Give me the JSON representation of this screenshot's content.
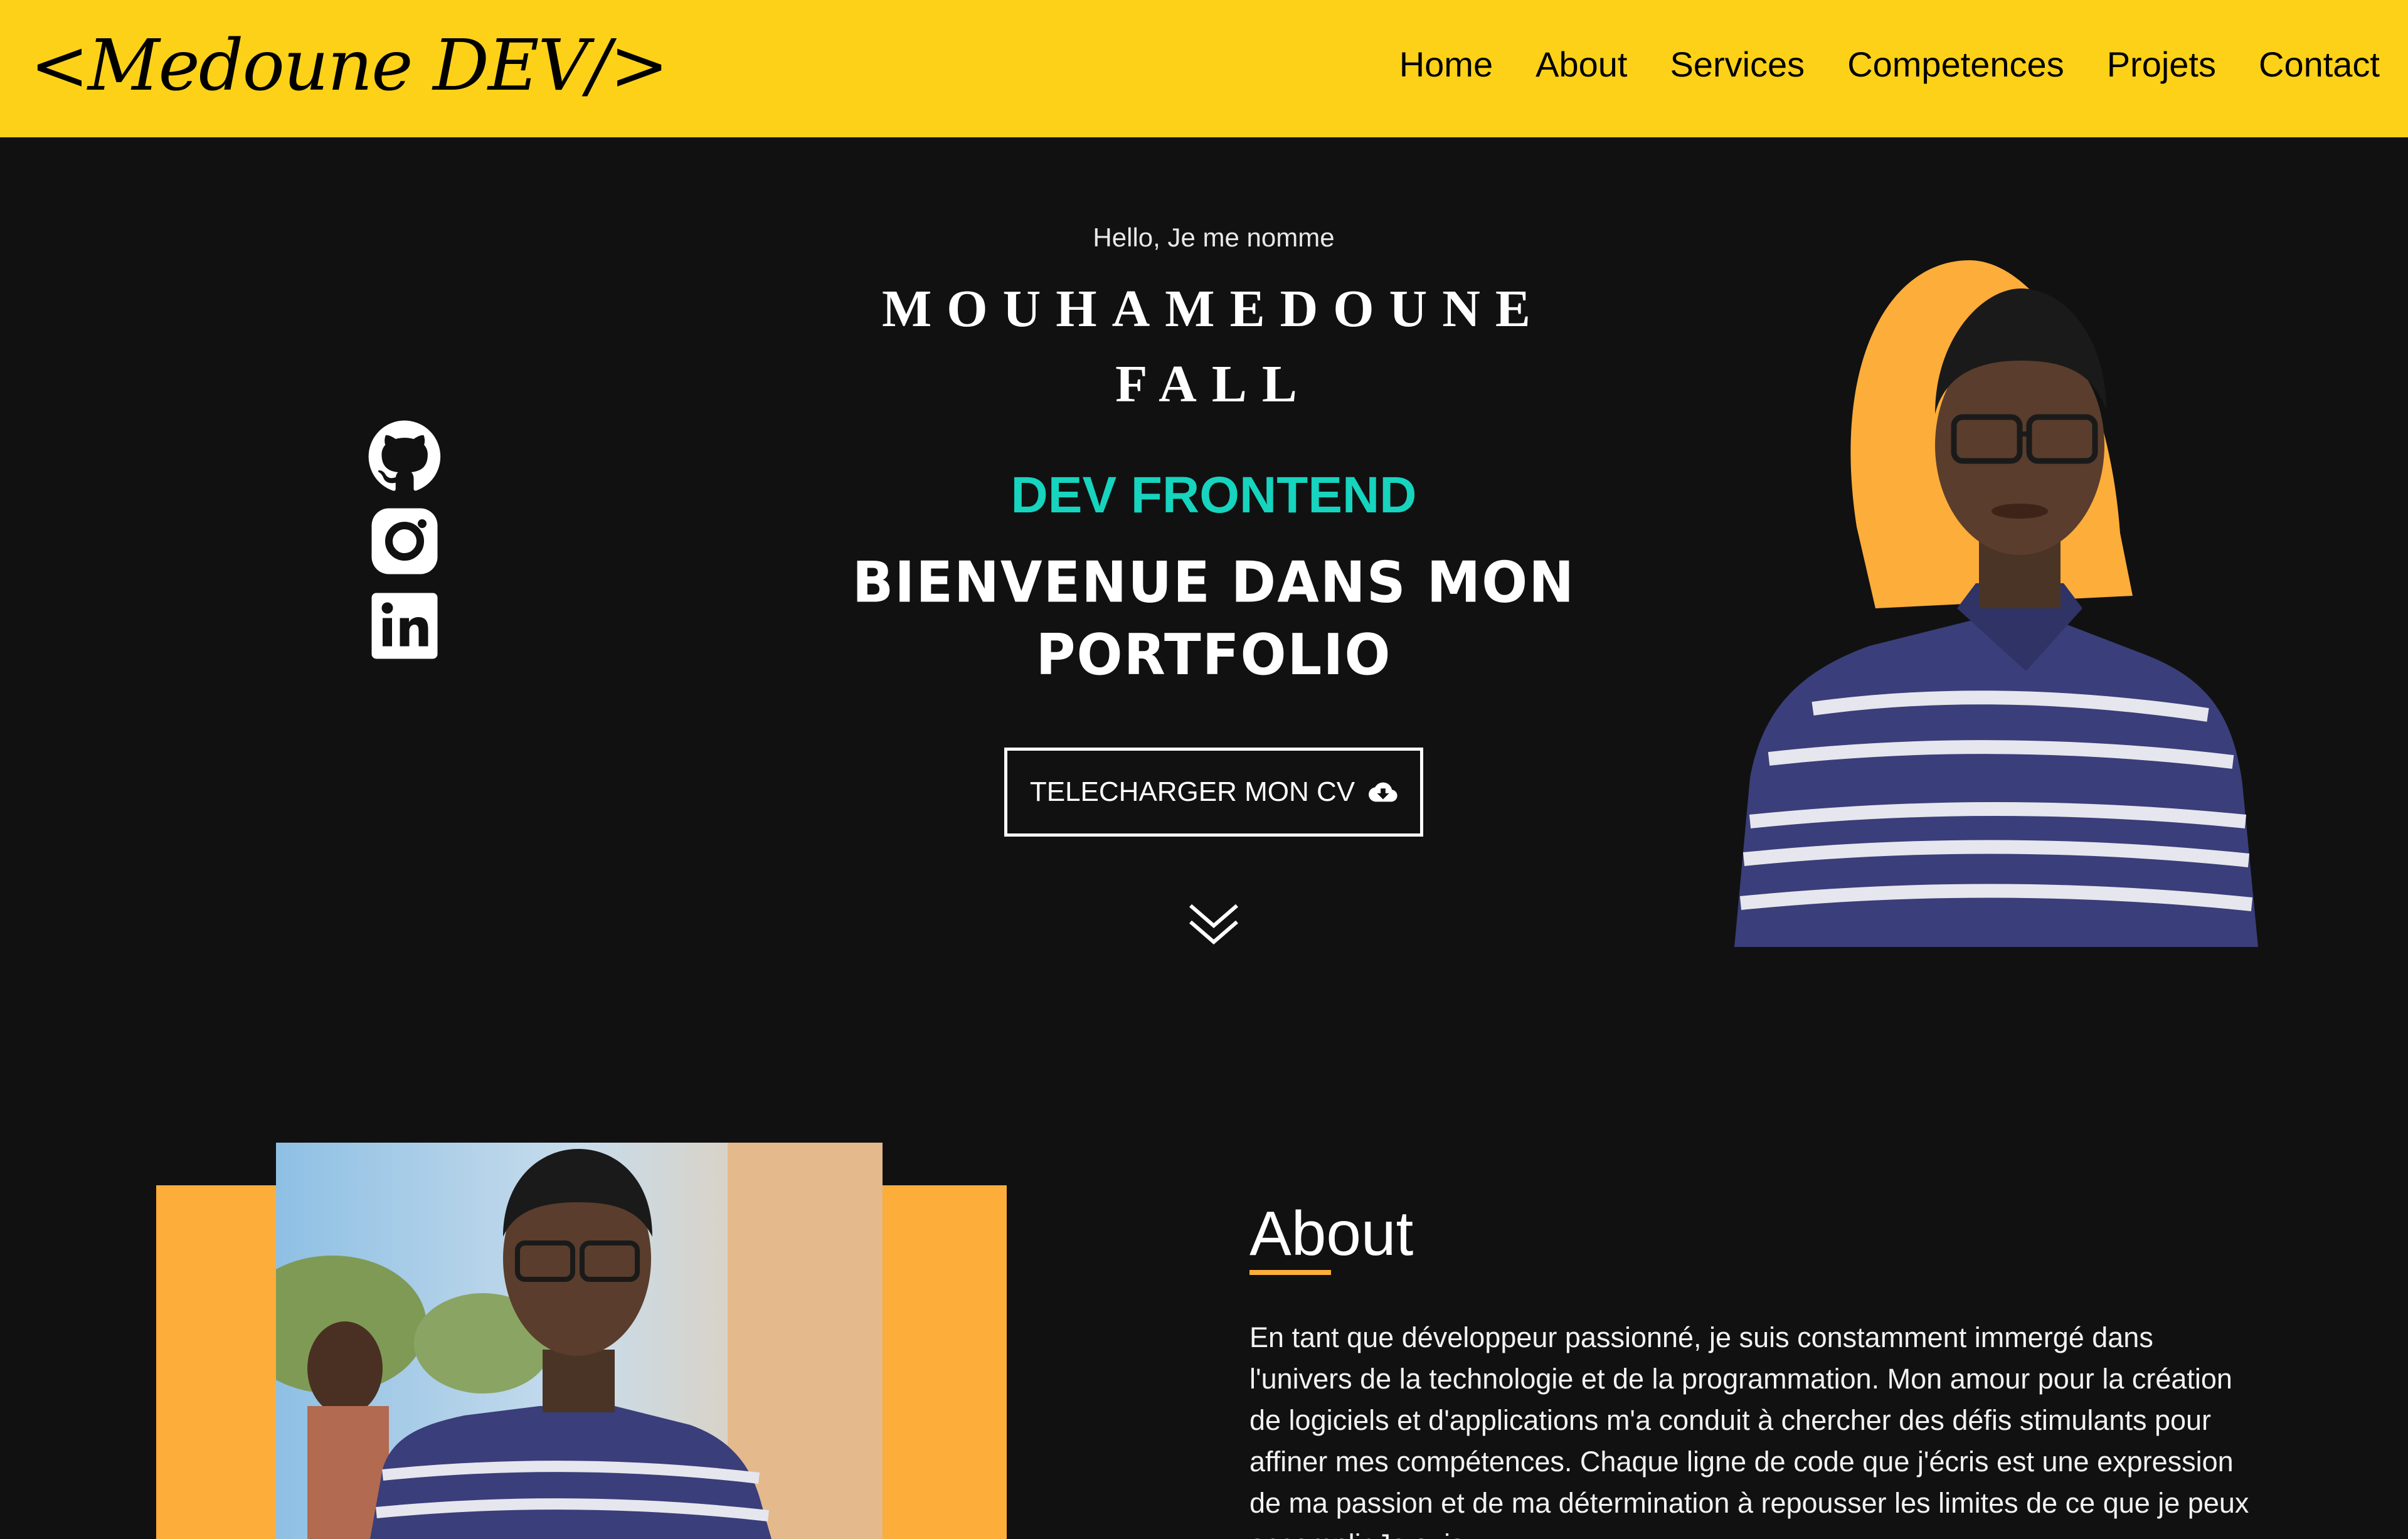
{
  "nav": {
    "logo": "<Medoune DEV/>",
    "links": [
      "Home",
      "About",
      "Services",
      "Competences",
      "Projets",
      "Contact"
    ]
  },
  "hero": {
    "greeting": "Hello, Je me nomme",
    "name_line1": "MOUHAMEDOUNE",
    "name_line2": "FALL",
    "role": "DEV FRONTEND",
    "welcome_line1": "BIENVENUE DANS MON",
    "welcome_line2": "PORTFOLIO",
    "cv_button": "TELECHARGER MON CV"
  },
  "social": [
    "github-icon",
    "instagram-icon",
    "linkedin-icon"
  ],
  "about": {
    "title": "About",
    "text": "En tant que développeur passionné, je suis constamment immergé dans l'univers de la technologie et de la programmation. Mon amour pour la création de logiciels et d'applications m'a conduit à chercher des défis stimulants pour affiner mes compétences. Chaque ligne de code que j'écris est une expression de ma passion et de ma détermination à repousser les limites de ce que je peux accomplir.Je suis"
  },
  "colors": {
    "navbar": "#fcd118",
    "accent": "#fcad3a",
    "role": "#16d4be",
    "background": "#111111"
  }
}
